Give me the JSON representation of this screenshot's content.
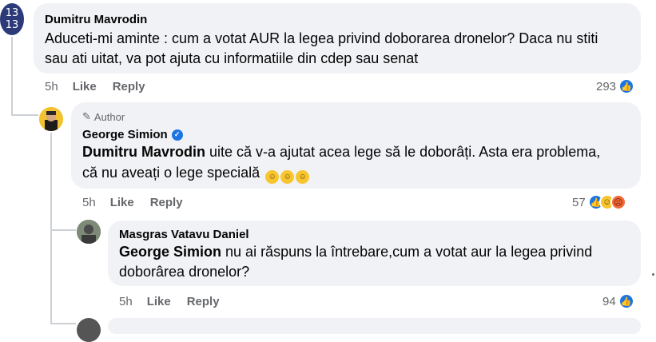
{
  "comments": [
    {
      "author": "Dumitru Mavrodin",
      "avatar_text": [
        "13",
        "13"
      ],
      "text_line1": "Aduceti-mi aminte : cum a votat AUR la legea privind doborarea dronelor? Daca nu stiti",
      "text_line2": "sau ati uitat, va pot ajuta cu informatiile din cdep sau senat",
      "time": "5h",
      "like": "Like",
      "reply": "Reply",
      "reaction_count": "293"
    },
    {
      "badge": "Author",
      "author": "George Simion",
      "mention": "Dumitru Mavrodin",
      "text_line1": " uite că v-a ajutat acea lege să le doborâți. Asta era problema,",
      "text_line2": "că nu aveați o lege specială",
      "time": "5h",
      "like": "Like",
      "reply": "Reply",
      "reaction_count": "57"
    },
    {
      "author": "Masgras Vatavu Daniel",
      "mention": "George Simion",
      "text_line1": " nu ai răspuns la întrebare,cum a votat aur la legea privind",
      "text_line2": "doborârea dronelor?",
      "time": "5h",
      "like": "Like",
      "reply": "Reply",
      "reaction_count": "94"
    }
  ],
  "icons": {
    "like": "like-icon",
    "haha": "haha-icon",
    "angry": "angry-icon",
    "verified": "verified-badge-icon",
    "author": "pencil-icon"
  },
  "colors": {
    "bubble": "#f0f2f5",
    "like_blue": "#1b74e4",
    "muted": "#65676b"
  }
}
